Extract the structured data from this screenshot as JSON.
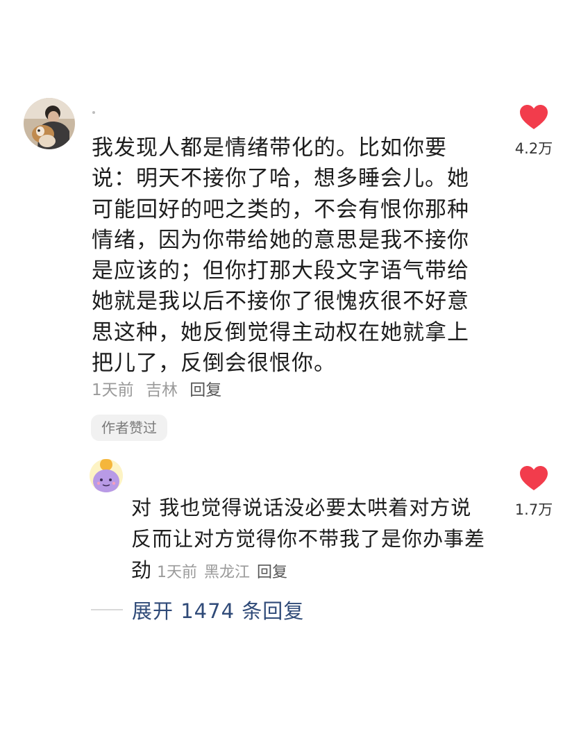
{
  "comment": {
    "text": "我发现人都是情绪带化的。比如你要说：明天不接你了哈，想多睡会儿。她可能回好的吧之类的，不会有恨你那种情绪，因为你带给她的意思是我不接你是应该的；但你打那大段文字语气带给她就是我以后不接你了很愧疚很不好意思这种，她反倒觉得主动权在她就拿上把儿了，反倒会很恨你。",
    "time": "1天前",
    "location": "吉林",
    "reply_label": "回复",
    "author_liked_badge": "作者赞过",
    "like_count": "4.2万"
  },
  "reply": {
    "text": "对 我也觉得说话没必要太哄着对方说 反而让对方觉得你不带我了是你办事差劲",
    "time": "1天前",
    "location": "黑龙江",
    "reply_label": "回复",
    "like_count": "1.7万"
  },
  "expand_label": "展开 1474 条回复",
  "colors": {
    "heart": "#f23c4c",
    "link": "#2f4a78",
    "muted": "#9a9a9a"
  }
}
